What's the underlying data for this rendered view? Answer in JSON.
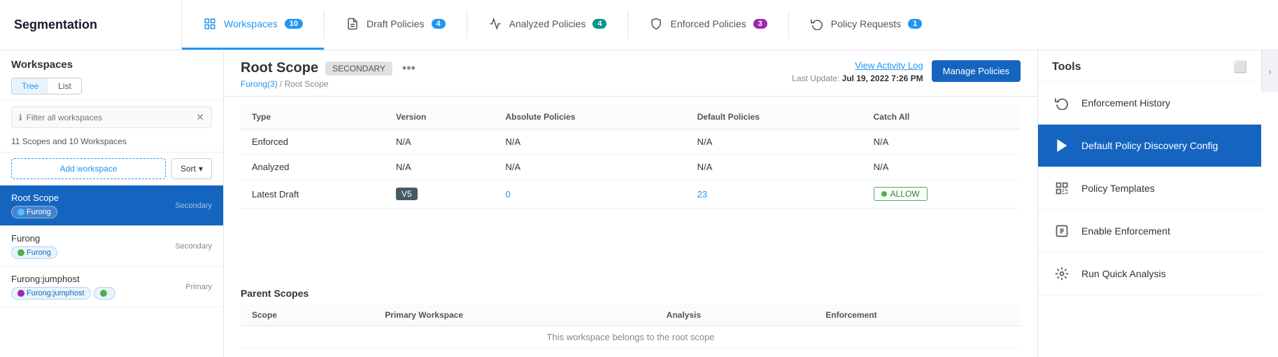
{
  "app": {
    "title": "Segmentation"
  },
  "tabs": [
    {
      "id": "workspaces",
      "label": "Workspaces",
      "badge": "10",
      "badge_color": "blue",
      "active": true,
      "icon": "workspaces-icon"
    },
    {
      "id": "draft",
      "label": "Draft Policies",
      "badge": "4",
      "badge_color": "blue",
      "active": false,
      "icon": "draft-icon"
    },
    {
      "id": "analyzed",
      "label": "Analyzed Policies",
      "badge": "4",
      "badge_color": "teal",
      "active": false,
      "icon": "analyzed-icon"
    },
    {
      "id": "enforced",
      "label": "Enforced Policies",
      "badge": "3",
      "badge_color": "purple",
      "active": false,
      "icon": "enforced-icon"
    },
    {
      "id": "requests",
      "label": "Policy Requests",
      "badge": "1",
      "badge_color": "blue",
      "active": false,
      "icon": "requests-icon"
    }
  ],
  "sidebar": {
    "title": "Workspaces",
    "view_tree": "Tree",
    "view_list": "List",
    "filter_placeholder": "Filter all workspaces",
    "scope_count": "11 Scopes and 10 Workspaces",
    "add_workspace_label": "Add workspace",
    "sort_label": "Sort",
    "workspaces": [
      {
        "name": "Root Scope",
        "type": "Secondary",
        "tags": [
          "Furong"
        ],
        "active": true
      },
      {
        "name": "Furong",
        "type": "Secondary",
        "tags": [
          "Furong"
        ],
        "active": false
      },
      {
        "name": "Furong:jumphost",
        "type": "Primary",
        "tags": [
          "Furong:jumphost"
        ],
        "active": false
      }
    ]
  },
  "scope": {
    "name": "Root Scope",
    "badge": "SECONDARY",
    "breadcrumb_parent": "Furong(3)",
    "breadcrumb_current": "Root Scope",
    "view_log_label": "View Activity Log",
    "manage_label": "Manage Policies",
    "last_update_label": "Last Update:",
    "last_update_value": "Jul 19, 2022 7:26 PM"
  },
  "policy_table": {
    "columns": [
      "Type",
      "Version",
      "Absolute Policies",
      "Default Policies",
      "Catch All"
    ],
    "rows": [
      {
        "type": "Enforced",
        "version": "N/A",
        "absolute": "N/A",
        "default": "N/A",
        "catch_all": "N/A"
      },
      {
        "type": "Analyzed",
        "version": "N/A",
        "absolute": "N/A",
        "default": "N/A",
        "catch_all": "N/A"
      },
      {
        "type": "Latest Draft",
        "version": "V5",
        "absolute": "0",
        "default": "23",
        "catch_all": "ALLOW"
      }
    ]
  },
  "parent_scopes": {
    "title": "Parent Scopes",
    "columns": [
      "Scope",
      "Primary Workspace",
      "Analysis",
      "Enforcement"
    ],
    "empty_message": "This workspace belongs to the root scope"
  },
  "tools": {
    "title": "Tools",
    "menu_icon": "more-icon",
    "items": [
      {
        "id": "enforcement-history",
        "label": "Enforcement History",
        "icon": "history-icon",
        "active": false
      },
      {
        "id": "default-policy",
        "label": "Default Policy Discovery Config",
        "icon": "play-icon",
        "active": true
      },
      {
        "id": "policy-templates",
        "label": "Policy Templates",
        "icon": "templates-icon",
        "active": false
      },
      {
        "id": "enable-enforcement",
        "label": "Enable Enforcement",
        "icon": "enforcement-icon",
        "active": false
      },
      {
        "id": "run-quick-analysis",
        "label": "Run Quick Analysis",
        "icon": "analysis-icon",
        "active": false
      }
    ]
  }
}
